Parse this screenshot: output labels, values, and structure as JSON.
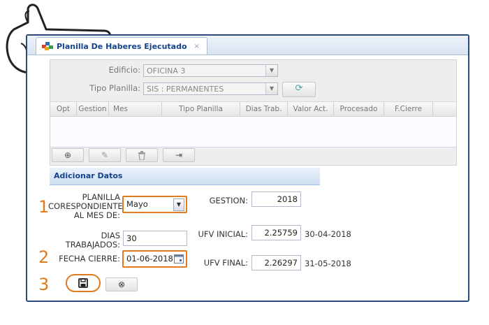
{
  "tab": {
    "title": "Planilla De Haberes Ejecutado",
    "close": "×"
  },
  "filters": {
    "edificio": {
      "label": "Edificio:",
      "value": "OFICINA 3"
    },
    "tipo_planilla": {
      "label": "Tipo Planilla:",
      "value": "SIS : PERMANENTES"
    }
  },
  "grid": {
    "columns": [
      "Opt",
      "Gestion",
      "Mes",
      "Tipo Planilla",
      "Dias Trab.",
      "Valor Act.",
      "Procesado",
      "F.Cierre"
    ]
  },
  "form": {
    "header": "Adicionar Datos",
    "planilla": {
      "label_lines": [
        "PLANILLA",
        "CORESPONDIENTE",
        "AL MES DE:"
      ],
      "value": "Mayo"
    },
    "gestion": {
      "label": "GESTION:",
      "value": "2018"
    },
    "dias": {
      "label_lines": [
        "DIAS",
        "TRABAJADOS:"
      ],
      "value": "30"
    },
    "ufv_inicial": {
      "label": "UFV INICIAL:",
      "value": "2.25759",
      "date": "30-04-2018"
    },
    "fecha_cierre": {
      "label": "FECHA CIERRE:",
      "value": "01-06-2018"
    },
    "ufv_final": {
      "label": "UFV FINAL:",
      "value": "2.26297",
      "date": "31-05-2018"
    }
  },
  "steps": [
    "1",
    "2",
    "3"
  ],
  "icons": {
    "add": "⊕",
    "edit": "✎",
    "delete": "🗑",
    "exit": "⇥",
    "refresh": "⟳",
    "save": "save-icon",
    "cancel": "⊗",
    "calendar": "calendar-icon",
    "dropdown": "▼"
  },
  "colors": {
    "accent": "#e07a1f",
    "header_text": "#15428b",
    "window_border": "#2b4a7a"
  }
}
